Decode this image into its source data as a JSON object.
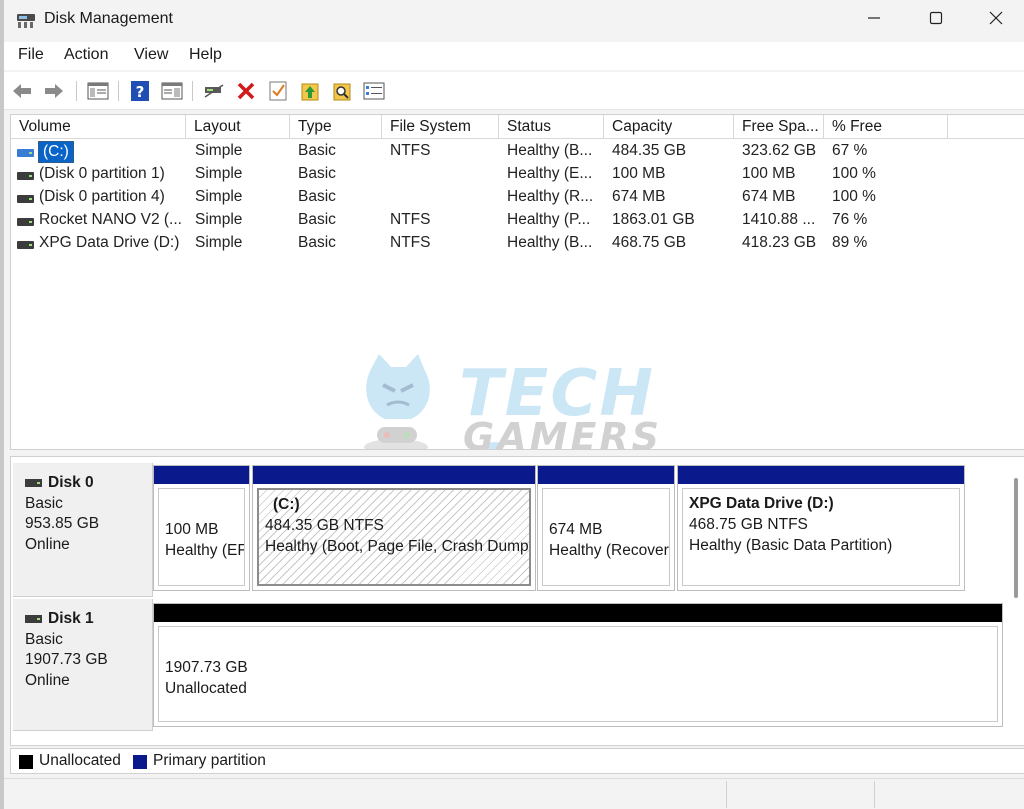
{
  "window": {
    "title": "Disk Management",
    "icon": "disk-management-icon",
    "minimize_icon": "minimize-icon",
    "maximize_icon": "maximize-icon",
    "close_icon": "close-icon"
  },
  "menu": {
    "items": [
      "File",
      "Action",
      "View",
      "Help"
    ]
  },
  "toolbar": {
    "icons": [
      "back-icon",
      "forward-icon",
      "show-hide-console-tree-icon",
      "help-icon",
      "properties-icon",
      "connect-icon",
      "delete-icon",
      "check-icon",
      "up-icon",
      "search-icon",
      "list-icon"
    ]
  },
  "volume_list": {
    "columns": [
      "Volume",
      "Layout",
      "Type",
      "File System",
      "Status",
      "Capacity",
      "Free Spa...",
      "% Free"
    ],
    "rows": [
      {
        "volume": "(C:)",
        "layout": "Simple",
        "type": "Basic",
        "fs": "NTFS",
        "status": "Healthy (B...",
        "capacity": "484.35 GB",
        "free": "323.62 GB",
        "pct": "67 %",
        "selected": true
      },
      {
        "volume": "(Disk 0 partition 1)",
        "layout": "Simple",
        "type": "Basic",
        "fs": "",
        "status": "Healthy (E...",
        "capacity": "100 MB",
        "free": "100 MB",
        "pct": "100 %",
        "selected": false
      },
      {
        "volume": "(Disk 0 partition 4)",
        "layout": "Simple",
        "type": "Basic",
        "fs": "",
        "status": "Healthy (R...",
        "capacity": "674 MB",
        "free": "674 MB",
        "pct": "100 %",
        "selected": false
      },
      {
        "volume": "Rocket NANO V2 (...",
        "layout": "Simple",
        "type": "Basic",
        "fs": "NTFS",
        "status": "Healthy (P...",
        "capacity": "1863.01 GB",
        "free": "1410.88 ...",
        "pct": "76 %",
        "selected": false
      },
      {
        "volume": "XPG Data Drive (D:)",
        "layout": "Simple",
        "type": "Basic",
        "fs": "NTFS",
        "status": "Healthy (B...",
        "capacity": "468.75 GB",
        "free": "418.23 GB",
        "pct": "89 %",
        "selected": false
      }
    ]
  },
  "watermark": {
    "line1": "TECH 4",
    "line2": "GAMERS"
  },
  "disks": [
    {
      "name": "Disk 0",
      "type": "Basic",
      "size": "953.85 GB",
      "state": "Online",
      "partitions": [
        {
          "title": "",
          "size": "100 MB",
          "status": "Healthy (EFI System Partition)",
          "bar_color": "#0a1a8c"
        },
        {
          "title": "(C:)",
          "size": "484.35 GB NTFS",
          "status": "Healthy (Boot, Page File, Crash Dump, Basic Data Partition)",
          "bar_color": "#0a1a8c"
        },
        {
          "title": "",
          "size": "674 MB",
          "status": "Healthy (Recovery Partition)",
          "bar_color": "#0a1a8c"
        },
        {
          "title": "XPG Data Drive  (D:)",
          "size": "468.75 GB NTFS",
          "status": "Healthy (Basic Data Partition)",
          "bar_color": "#0a1a8c"
        }
      ]
    },
    {
      "name": "Disk 1",
      "type": "Basic",
      "size": "1907.73 GB",
      "state": "Online",
      "partitions": [
        {
          "title": "",
          "size": "1907.73 GB",
          "status": "Unallocated",
          "bar_color": "#000000"
        }
      ]
    }
  ],
  "legend": [
    {
      "label": "Unallocated",
      "color": "#000000"
    },
    {
      "label": "Primary partition",
      "color": "#0a1a8c"
    }
  ]
}
